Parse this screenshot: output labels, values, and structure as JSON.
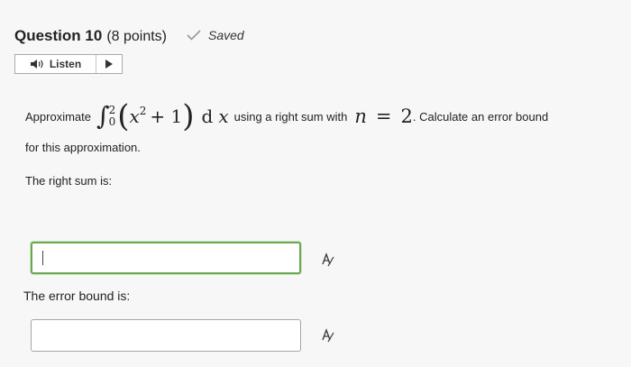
{
  "question": {
    "title": "Question 10",
    "points": "(8 points)",
    "saved_label": "Saved"
  },
  "listen": {
    "label": "Listen"
  },
  "problem": {
    "prefix": "Approximate",
    "integral": {
      "lower": "0",
      "upper": "2",
      "var": "x",
      "exp": "2",
      "plus": "+ 1",
      "d": "d"
    },
    "mid_text": "using a right sum with",
    "n_var": "n",
    "n_eq": "=",
    "n_val": "2",
    "suffix": ". Calculate an error bound",
    "line2": "for this approximation."
  },
  "right_sum": {
    "label": "The right sum is:",
    "value": ""
  },
  "error_bound": {
    "label": "The error bound is:",
    "value": ""
  },
  "colors": {
    "focus_border": "#6aa84f",
    "input_border": "#a6a6a6",
    "background": "#f7f7f7"
  },
  "icons": [
    "check-icon",
    "speaker-icon",
    "play-icon",
    "equation-editor-icon"
  ]
}
